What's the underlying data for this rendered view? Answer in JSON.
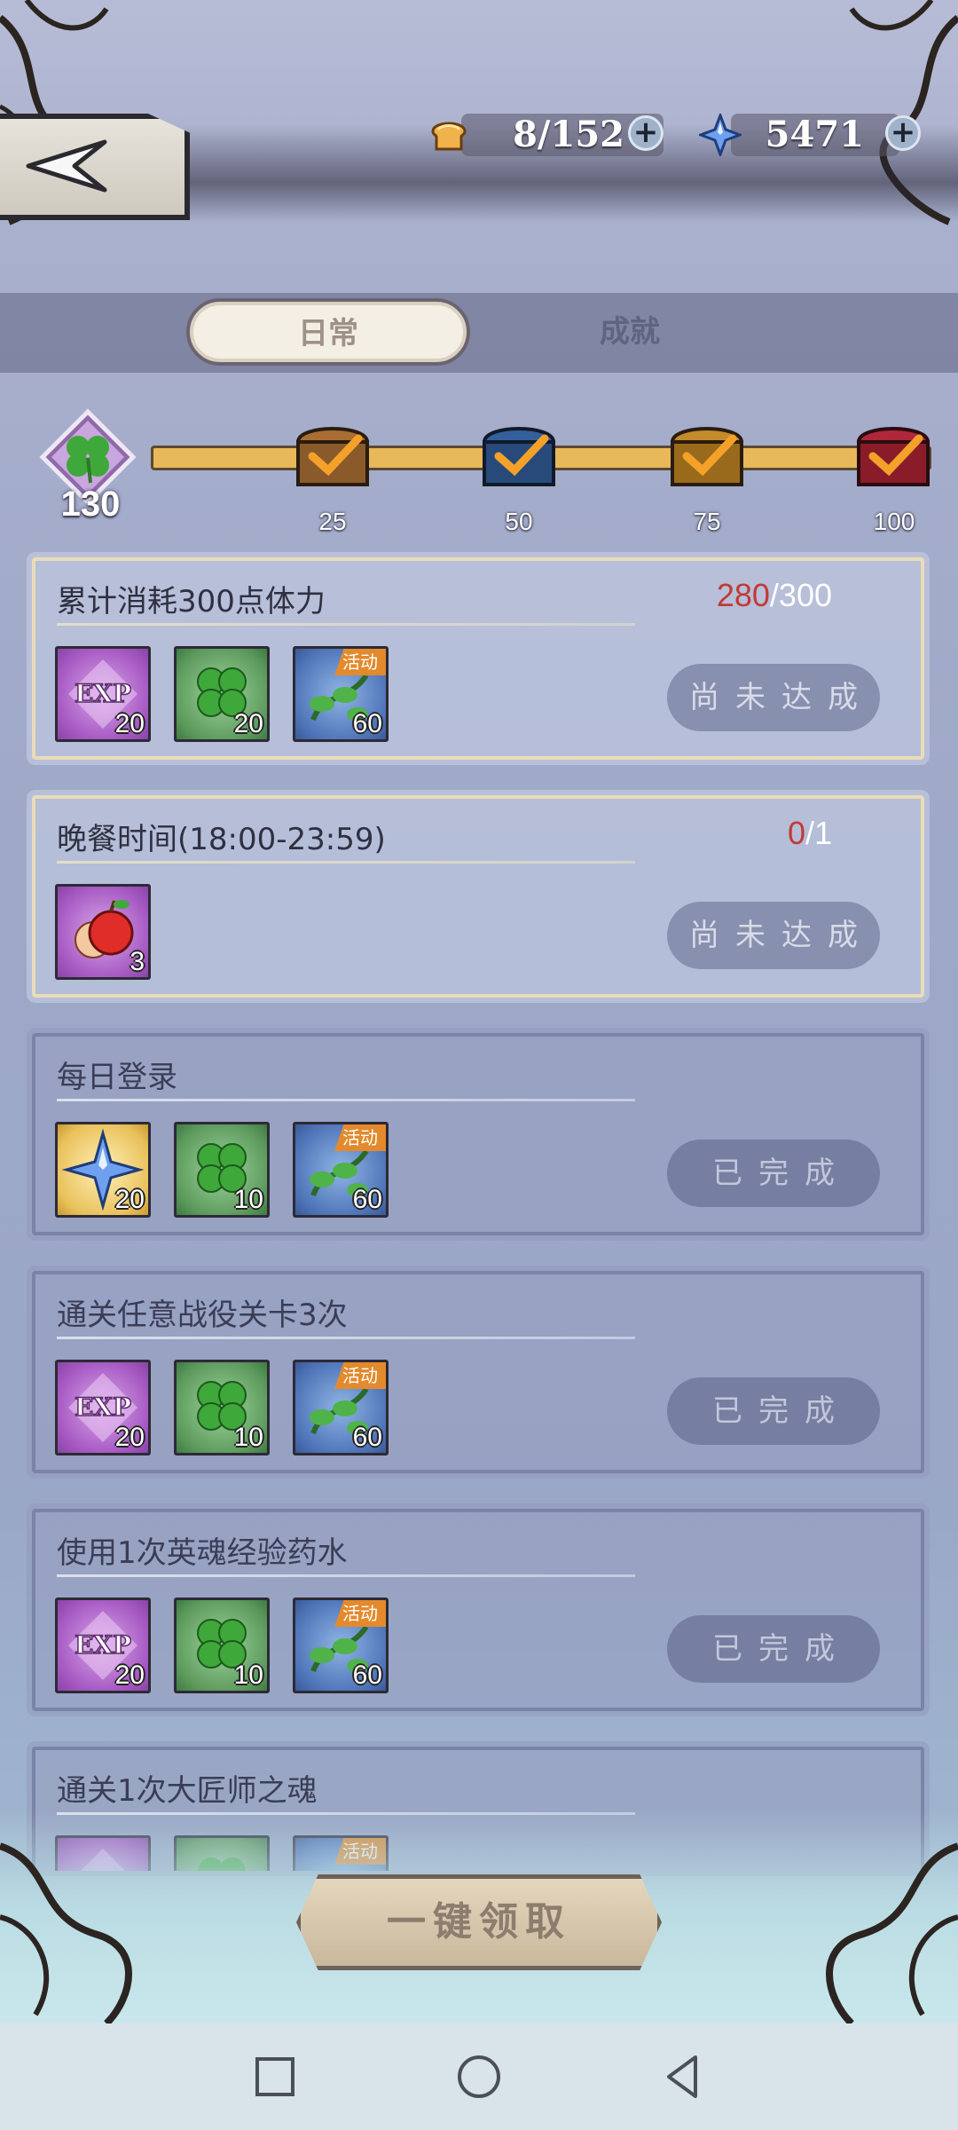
{
  "top_bar": {
    "stamina": "8/152",
    "gems": "5471"
  },
  "tabs": {
    "daily": "日常",
    "achievement": "成就"
  },
  "progress": {
    "clover_points": "130",
    "milestones": [
      "25",
      "50",
      "75",
      "100"
    ]
  },
  "tasks": [
    {
      "title": "累计消耗300点体力",
      "progress_current": "280",
      "progress_total": "/300",
      "button": "尚未达成",
      "rewards": [
        {
          "icon": "exp-icon",
          "qty": "20"
        },
        {
          "icon": "clover-icon",
          "qty": "20"
        },
        {
          "icon": "event-vine-icon",
          "qty": "60",
          "tag": "活动"
        }
      ]
    },
    {
      "title": "晚餐时间(18:00-23:59)",
      "progress_current": "0",
      "progress_total": "/1",
      "button": "尚未达成",
      "rewards": [
        {
          "icon": "apple-icon",
          "qty": "3"
        }
      ]
    },
    {
      "title": "每日登录",
      "button": "已完成",
      "rewards": [
        {
          "icon": "gem-icon",
          "qty": "20"
        },
        {
          "icon": "clover-icon",
          "qty": "10"
        },
        {
          "icon": "event-vine-icon",
          "qty": "60",
          "tag": "活动"
        }
      ]
    },
    {
      "title": "通关任意战役关卡3次",
      "button": "已完成",
      "rewards": [
        {
          "icon": "exp-icon",
          "qty": "20"
        },
        {
          "icon": "clover-icon",
          "qty": "10"
        },
        {
          "icon": "event-vine-icon",
          "qty": "60",
          "tag": "活动"
        }
      ]
    },
    {
      "title": "使用1次英魂经验药水",
      "button": "已完成",
      "rewards": [
        {
          "icon": "exp-icon",
          "qty": "20"
        },
        {
          "icon": "clover-icon",
          "qty": "10"
        },
        {
          "icon": "event-vine-icon",
          "qty": "60",
          "tag": "活动"
        }
      ]
    },
    {
      "title": "通关1次大匠师之魂",
      "rewards": [
        {
          "icon": "exp-icon"
        },
        {
          "icon": "clover-icon"
        },
        {
          "icon": "event-vine-icon",
          "tag": "活动"
        }
      ]
    }
  ],
  "claim_all_button": "一键领取",
  "colors": {
    "progress_red": "#c23a36",
    "track_gold": "#e9b85a",
    "tag_orange": "#e38a2d"
  }
}
